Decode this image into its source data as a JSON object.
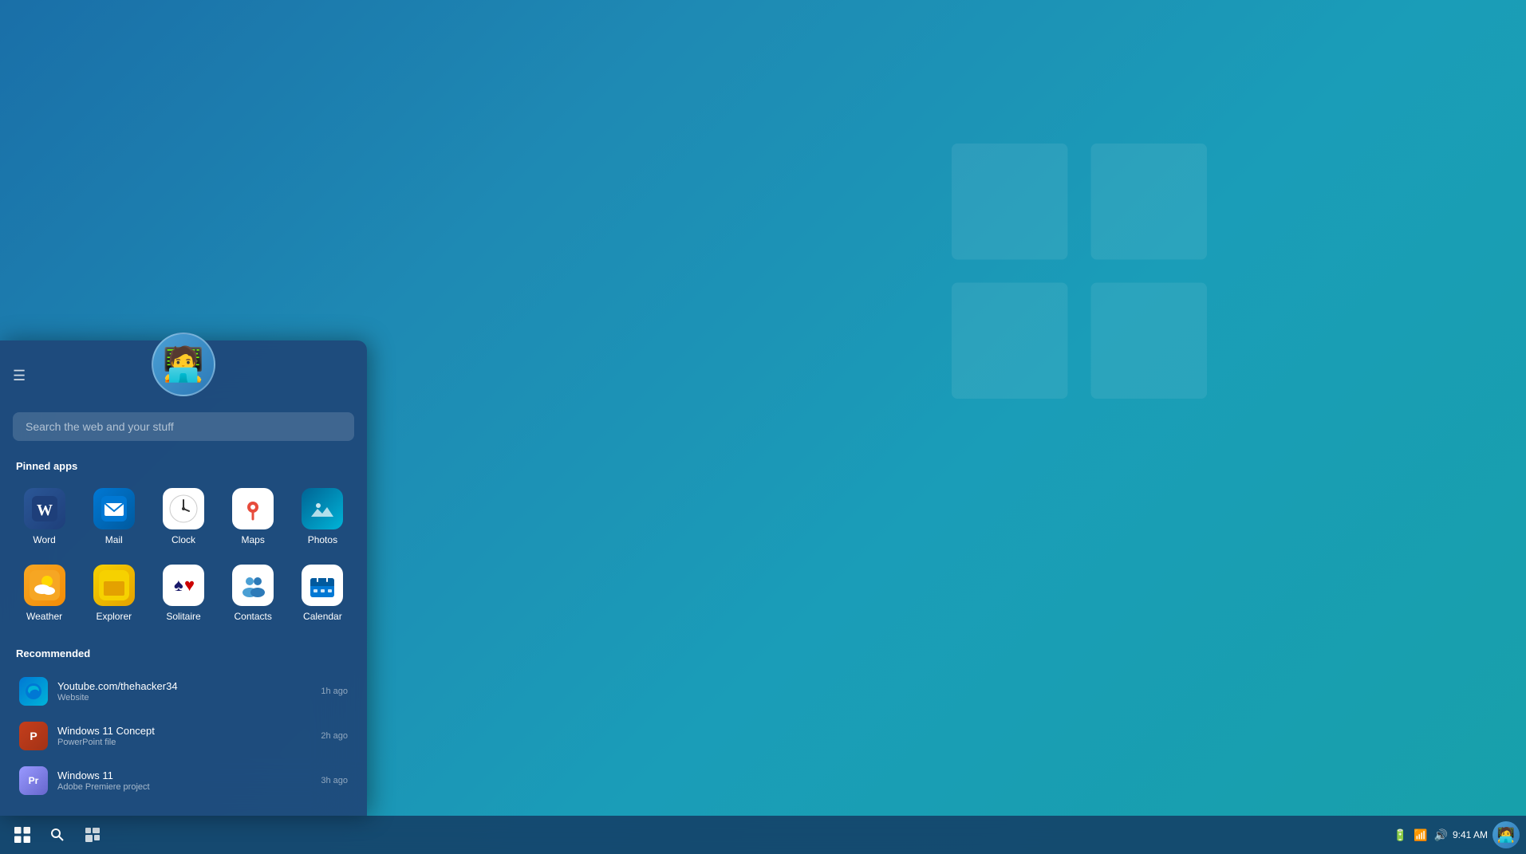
{
  "desktop": {
    "background": "linear-gradient(135deg, #1a6fa8 0%, #1e8ab4 30%, #1a9db8 60%, #17a0aa 100%)"
  },
  "startMenu": {
    "hamburger_label": "☰",
    "user_emoji": "🧑‍💻",
    "search_placeholder": "Search the web and your stuff",
    "pinned_title": "Pinned apps",
    "recommended_title": "Recommended",
    "pinned_apps": [
      {
        "id": "word",
        "label": "Word",
        "icon": "W",
        "icon_class": "icon-word",
        "emoji": ""
      },
      {
        "id": "mail",
        "label": "Mail",
        "icon": "✉",
        "icon_class": "icon-mail",
        "emoji": ""
      },
      {
        "id": "clock",
        "label": "Clock",
        "icon": "🕐",
        "icon_class": "icon-clock",
        "emoji": ""
      },
      {
        "id": "maps",
        "label": "Maps",
        "icon": "📍",
        "icon_class": "icon-maps",
        "emoji": ""
      },
      {
        "id": "photos",
        "label": "Photos",
        "icon": "🖼",
        "icon_class": "icon-photos",
        "emoji": ""
      },
      {
        "id": "weather",
        "label": "Weather",
        "icon": "☀",
        "icon_class": "icon-weather",
        "emoji": ""
      },
      {
        "id": "explorer",
        "label": "Explorer",
        "icon": "📁",
        "icon_class": "icon-explorer",
        "emoji": ""
      },
      {
        "id": "solitaire",
        "label": "Solitaire",
        "icon": "🃏",
        "icon_class": "icon-solitaire",
        "emoji": ""
      },
      {
        "id": "contacts",
        "label": "Contacts",
        "icon": "👥",
        "icon_class": "icon-contacts",
        "emoji": ""
      },
      {
        "id": "calendar",
        "label": "Calendar",
        "icon": "📅",
        "icon_class": "icon-calendar",
        "emoji": ""
      }
    ],
    "recommended": [
      {
        "id": "youtube",
        "name": "Youtube.com/thehacker34",
        "type": "Website",
        "time": "1h ago",
        "icon_class": "edge-icon",
        "icon": "e"
      },
      {
        "id": "win11concept",
        "name": "Windows 11 Concept",
        "type": "PowerPoint file",
        "time": "2h ago",
        "icon_class": "powerpoint-icon",
        "icon": "P"
      },
      {
        "id": "win11",
        "name": "Windows 11",
        "type": "Adobe Premiere project",
        "time": "3h ago",
        "icon_class": "premiere-icon",
        "icon": "Pr"
      }
    ]
  },
  "taskbar": {
    "time": "9:41 AM",
    "start_icon": "⊞",
    "search_icon": "🔍",
    "task_icon": "⊟",
    "battery_icon": "🔋",
    "wifi_icon": "📶",
    "volume_icon": "🔊"
  }
}
